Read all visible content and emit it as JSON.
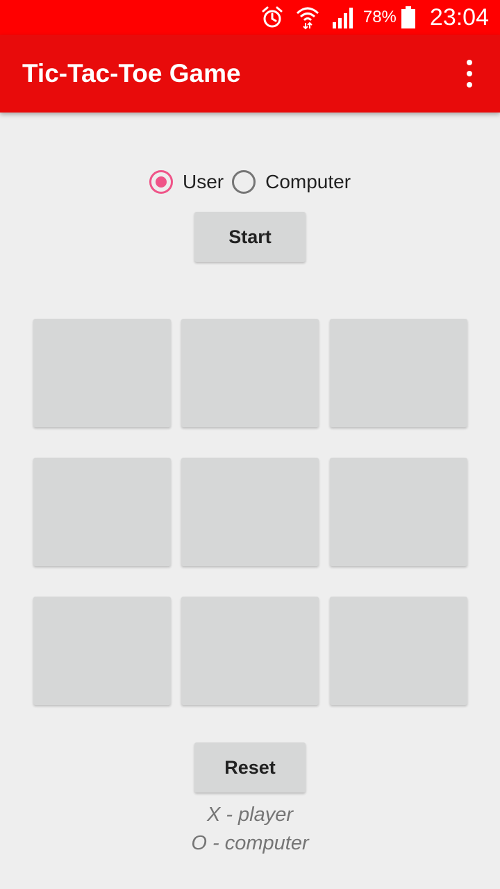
{
  "status_bar": {
    "background": "#ff0000",
    "icons": [
      "alarm-icon",
      "wifi-icon",
      "cell-signal-icon",
      "battery-icon"
    ],
    "battery_percent": "78%",
    "time": "23:04"
  },
  "app_bar": {
    "title": "Tic-Tac-Toe Game",
    "background": "#e80b0b",
    "menu_icon": "overflow-menu-icon"
  },
  "first_player": {
    "options": [
      {
        "label": "User",
        "checked": true
      },
      {
        "label": "Computer",
        "checked": false
      }
    ],
    "accent": "#ef5488"
  },
  "start_button": {
    "label": "Start"
  },
  "board": {
    "cells": [
      [
        "",
        "",
        ""
      ],
      [
        "",
        "",
        ""
      ],
      [
        "",
        "",
        ""
      ]
    ]
  },
  "reset_button": {
    "label": "Reset"
  },
  "legend": {
    "x_line": "X - player",
    "o_line": "O - computer"
  }
}
